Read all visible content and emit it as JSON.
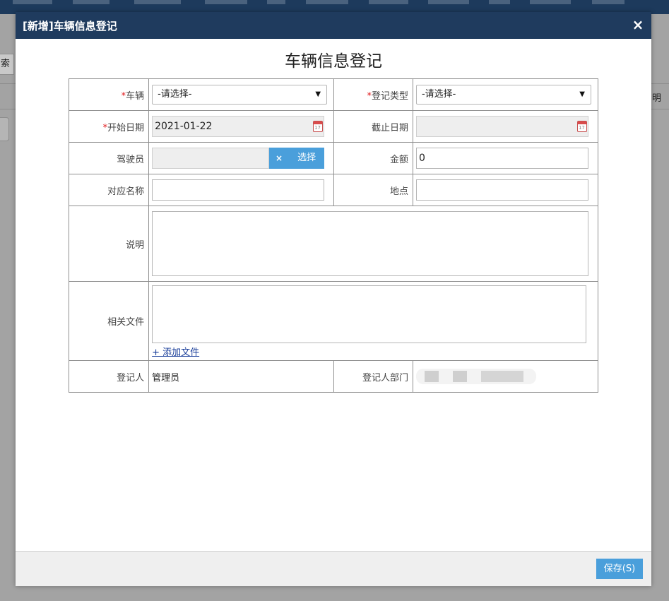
{
  "background": {
    "search_button_label": "索",
    "right_column_label": "明"
  },
  "dialog": {
    "title": "[新增]车辆信息登记",
    "close_icon": "×"
  },
  "form": {
    "heading": "车辆信息登记",
    "required_mark": "*",
    "vehicle": {
      "label": "车辆",
      "value": "-请选择-",
      "arrow": "▼"
    },
    "register_type": {
      "label": "登记类型",
      "value": "-请选择-",
      "arrow": "▼"
    },
    "start_date": {
      "label": "开始日期",
      "value": "2021-01-22"
    },
    "end_date": {
      "label": "截止日期",
      "value": ""
    },
    "driver": {
      "label": "驾驶员",
      "value": "",
      "clear_label": "×",
      "select_label": "选择"
    },
    "amount": {
      "label": "金额",
      "value": "0"
    },
    "counterparty": {
      "label": "对应名称",
      "value": ""
    },
    "location": {
      "label": "地点",
      "value": ""
    },
    "description": {
      "label": "说明",
      "value": ""
    },
    "files": {
      "label": "相关文件",
      "add_label": "+ 添加文件"
    },
    "registrant": {
      "label": "登记人",
      "value": "管理员"
    },
    "registrant_dept": {
      "label": "登记人部门"
    }
  },
  "footer": {
    "save_label": "保存(S)"
  }
}
